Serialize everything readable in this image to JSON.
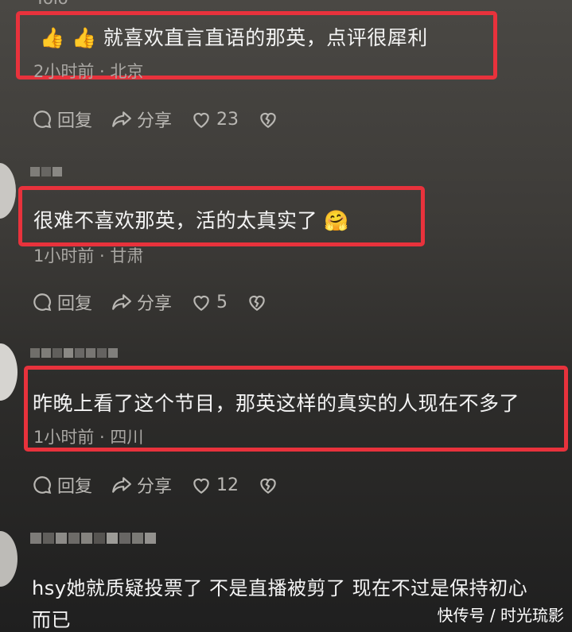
{
  "comments": [
    {
      "username": "Yolo",
      "text": "就喜欢直言直语的那英，点评很犀利",
      "emoji": "👍 👍",
      "meta": "2小时前 · 北京",
      "reply_label": "回复",
      "share_label": "分享",
      "like_count": "23"
    },
    {
      "text": "很难不喜欢那英，活的太真实了",
      "emoji": "🤗",
      "meta": "1小时前 · 甘肃",
      "reply_label": "回复",
      "share_label": "分享",
      "like_count": "5"
    },
    {
      "text": "昨晚上看了这个节目，那英这样的真实的人现在不多了",
      "meta": "1小时前 · 四川",
      "reply_label": "回复",
      "share_label": "分享",
      "like_count": "12"
    },
    {
      "text_line1": "hsy她就质疑投票了 不是直播被剪了 现在不过是保持初心",
      "text_line2": "而已"
    }
  ],
  "watermark": "快传号 / 时光琉影",
  "colors": {
    "highlight_box": "#e8323c",
    "background": "#3d3b38"
  },
  "icons": [
    "reply-bubble-icon",
    "share-arrow-icon",
    "heart-icon",
    "broken-heart-icon"
  ]
}
